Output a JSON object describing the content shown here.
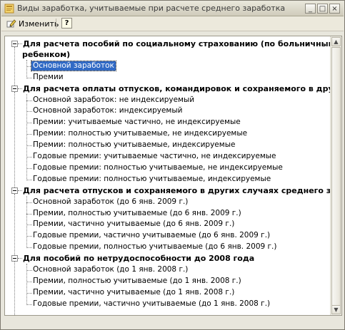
{
  "window": {
    "title": "Виды заработка, учитываемые при расчете среднего заработка",
    "controls": {
      "minimize": "_",
      "maximize": "□",
      "close": "×"
    }
  },
  "toolbar": {
    "change_label": "Изменить",
    "help_label": "?"
  },
  "tree": {
    "groups": [
      {
        "label_line1": "Для расчета пособий по социальному страхованию (по больничным листа",
        "label_line2": "ребенком)",
        "items": [
          "Основной заработок",
          "Премии"
        ]
      },
      {
        "label_line1": "Для расчета оплаты отпусков, командировок и сохраняемого в других сл",
        "items": [
          "Основной заработок: не индексируемый",
          "Основной заработок: индексируемый",
          "Премии: учитываемые частично, не индексируемые",
          "Премии: полностью учитываемые, не индексируемые",
          "Премии: полностью учитываемые, индексируемые",
          "Годовые премии: учитываемые частично, не индексируемые",
          "Годовые премии: полностью учитываемые, не индексируемые",
          "Годовые премии: полностью учитываемые, индексируемые"
        ]
      },
      {
        "label_line1": "Для расчета отпусков и сохраняемого в других случаях среднего зарабо",
        "items": [
          "Основной заработок (до 6 янв. 2009 г.)",
          "Премии, полностью учитываемые (до 6 янв. 2009 г.)",
          "Премии, частично учитываемые (до 6 янв. 2009 г.)",
          "Годовые премии, частично учитываемые (до 6 янв. 2009 г.)",
          "Годовые премии, полностью учитываемые (до 6 янв. 2009 г.)"
        ]
      },
      {
        "label_line1": "Для пособий по нетрудоспособности до 2008 года",
        "items": [
          "Основной заработок (до 1 янв. 2008 г.)",
          "Премии, полностью учитываемые (до 1 янв. 2008 г.)",
          "Премии, частично учитываемые (до 1 янв. 2008 г.)",
          "Годовые премии, частично учитываемые (до 1 янв. 2008 г.)"
        ]
      }
    ],
    "selected_item": "Основной заработок"
  },
  "colors": {
    "selection": "#316ac5",
    "window_bg": "#e8e6dc"
  }
}
